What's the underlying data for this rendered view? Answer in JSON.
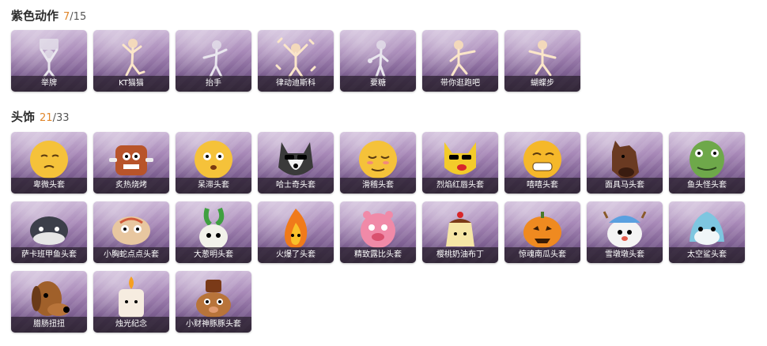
{
  "sections": {
    "purple_actions": {
      "title": "紫色动作",
      "owned": "7",
      "total": "/15",
      "items": [
        {
          "label": "举牌",
          "icon": "raise-sign-pose-icon"
        },
        {
          "label": "KT猫猫",
          "icon": "cat-pose-icon"
        },
        {
          "label": "抬手",
          "icon": "raise-hand-pose-icon"
        },
        {
          "label": "律动迪斯科",
          "icon": "disco-pose-icon"
        },
        {
          "label": "要糖",
          "icon": "ask-candy-pose-icon"
        },
        {
          "label": "带你逛跑吧",
          "icon": "run-pose-icon"
        },
        {
          "label": "蝴蝶步",
          "icon": "butterfly-step-pose-icon"
        }
      ]
    },
    "headwear": {
      "title": "头饰",
      "owned": "21",
      "total": "/33",
      "items": [
        {
          "label": "卑微头套",
          "icon": "humble-face-mask-icon"
        },
        {
          "label": "炙热烧烤",
          "icon": "hot-bbq-mask-icon"
        },
        {
          "label": "呆滞头套",
          "icon": "dazed-face-mask-icon"
        },
        {
          "label": "哈士奇头套",
          "icon": "husky-mask-icon"
        },
        {
          "label": "滑稽头套",
          "icon": "funny-face-mask-icon"
        },
        {
          "label": "烈焰红唇头套",
          "icon": "red-lips-mask-icon"
        },
        {
          "label": "嘻嘻头套",
          "icon": "grin-face-mask-icon"
        },
        {
          "label": "面具马头套",
          "icon": "horse-mask-icon"
        },
        {
          "label": "鱼头怪头套",
          "icon": "fish-monster-mask-icon"
        },
        {
          "label": "萨卡班甲鱼头套",
          "icon": "sacabambaspis-mask-icon"
        },
        {
          "label": "小胸蛇点点头套",
          "icon": "snake-mask-icon"
        },
        {
          "label": "大葱明头套",
          "icon": "scallion-mask-icon"
        },
        {
          "label": "火爆了头套",
          "icon": "fire-mask-icon"
        },
        {
          "label": "精致露比头套",
          "icon": "ruby-mask-icon"
        },
        {
          "label": "樱桃奶油布丁",
          "icon": "cherry-pudding-mask-icon"
        },
        {
          "label": "惊魂南瓜头套",
          "icon": "pumpkin-mask-icon"
        },
        {
          "label": "雪墩墩头套",
          "icon": "snow-mask-icon"
        },
        {
          "label": "太空鲨头套",
          "icon": "space-shark-mask-icon"
        },
        {
          "label": "腊肠扭扭",
          "icon": "dachshund-mask-icon"
        },
        {
          "label": "烛光纪念",
          "icon": "candle-mask-icon"
        },
        {
          "label": "小财神豚豚头套",
          "icon": "fortune-pig-mask-icon"
        }
      ]
    }
  },
  "colors": {
    "card_top": "#cdb9d8",
    "card_bottom": "#4d3d57",
    "owned_count": "#e0862b"
  }
}
